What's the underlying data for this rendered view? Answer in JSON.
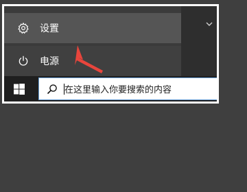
{
  "menu": {
    "settings_label": "设置",
    "settings_icon": "gear-icon",
    "power_label": "电源",
    "power_icon": "power-icon"
  },
  "taskbar": {
    "start_icon": "windows-logo-icon",
    "search_icon": "search-icon",
    "search_placeholder": "在这里输入你要搜索的内容"
  },
  "annotation": {
    "arrow_color": "#e8453c"
  },
  "colors": {
    "settings_highlight": "#555555",
    "menu_background": "#3b3b3b",
    "taskbar_background": "#1f1f1f"
  }
}
